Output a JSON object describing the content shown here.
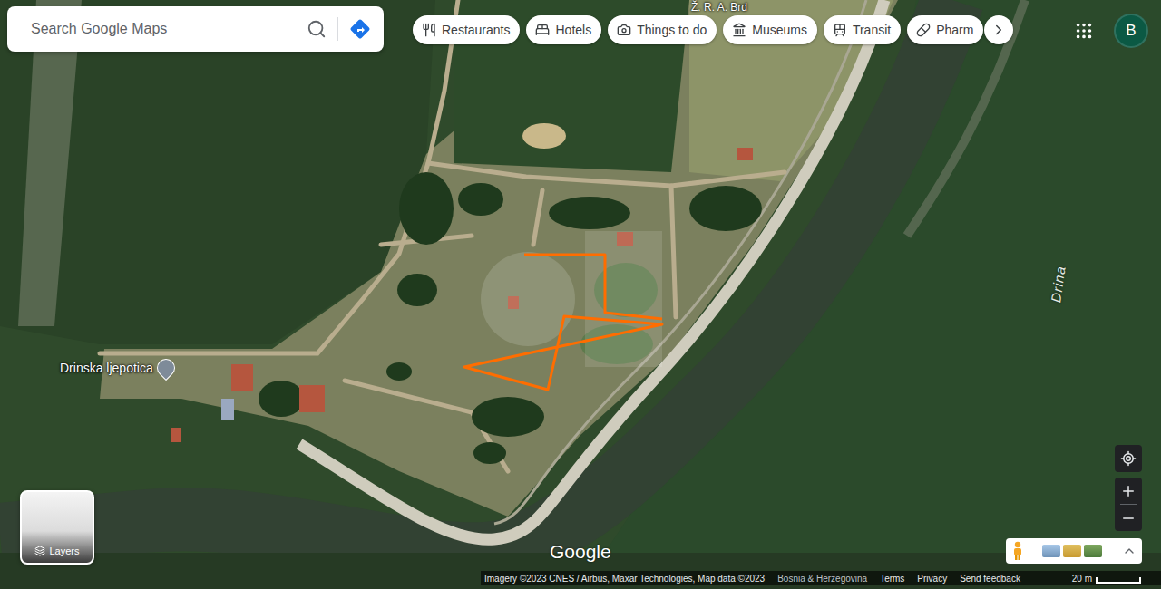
{
  "search": {
    "placeholder": "Search Google Maps"
  },
  "categories": [
    {
      "label": "Restaurants"
    },
    {
      "label": "Hotels"
    },
    {
      "label": "Things to do"
    },
    {
      "label": "Museums"
    },
    {
      "label": "Transit"
    },
    {
      "label": "Pharm"
    }
  ],
  "account": {
    "initial": "B"
  },
  "map": {
    "places": [
      {
        "name": "Drinska ljepotica"
      }
    ],
    "river_label": "Drina",
    "poi_label": "Ž. R. A. Brd"
  },
  "logo": "Google",
  "layers": {
    "label": "Layers"
  },
  "footer": {
    "attribution": "Imagery ©2023 CNES / Airbus, Maxar Technologies, Map data ©2023",
    "links": [
      "Bosnia & Herzegovina",
      "Terms",
      "Privacy",
      "Send feedback"
    ],
    "scale": "20 m"
  }
}
